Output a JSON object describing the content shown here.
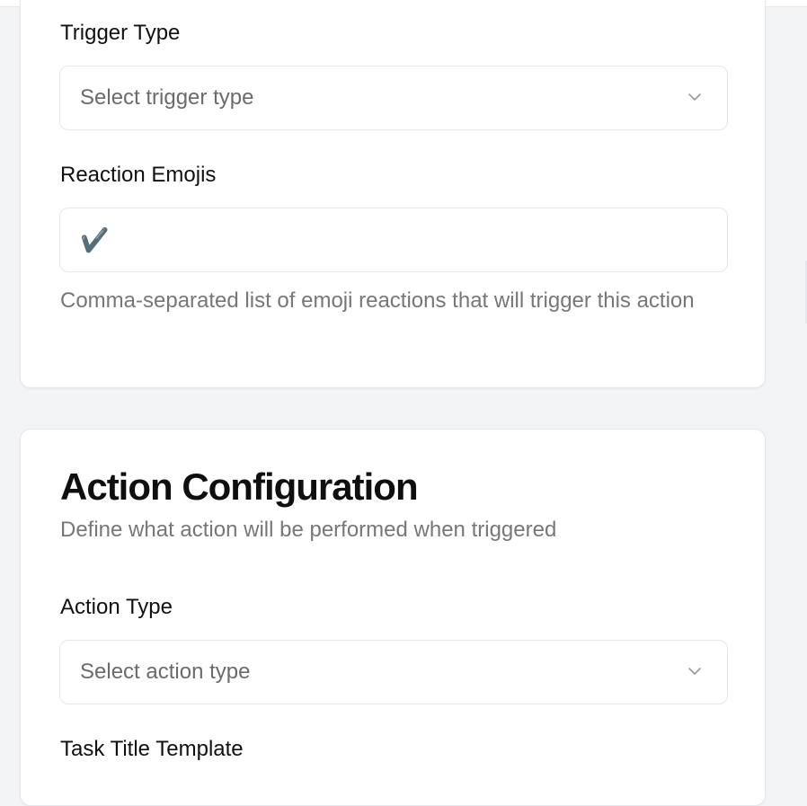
{
  "trigger_card": {
    "trigger_type_label": "Trigger Type",
    "trigger_type_placeholder": "Select trigger type",
    "reaction_emojis_label": "Reaction Emojis",
    "reaction_emojis_value": "✔️",
    "reaction_emojis_help": "Comma-separated list of emoji reactions that will trigger this action"
  },
  "action_card": {
    "title": "Action Configuration",
    "description": "Define what action will be performed when triggered",
    "action_type_label": "Action Type",
    "action_type_placeholder": "Select action type",
    "task_title_template_label": "Task Title Template"
  },
  "icons": {
    "select_chevron": "chevron-down-icon"
  },
  "colors": {
    "page_background": "#f3f4f6",
    "card_background": "#ffffff",
    "border": "#e5e7eb",
    "muted_text": "#777777",
    "text": "#111111"
  }
}
